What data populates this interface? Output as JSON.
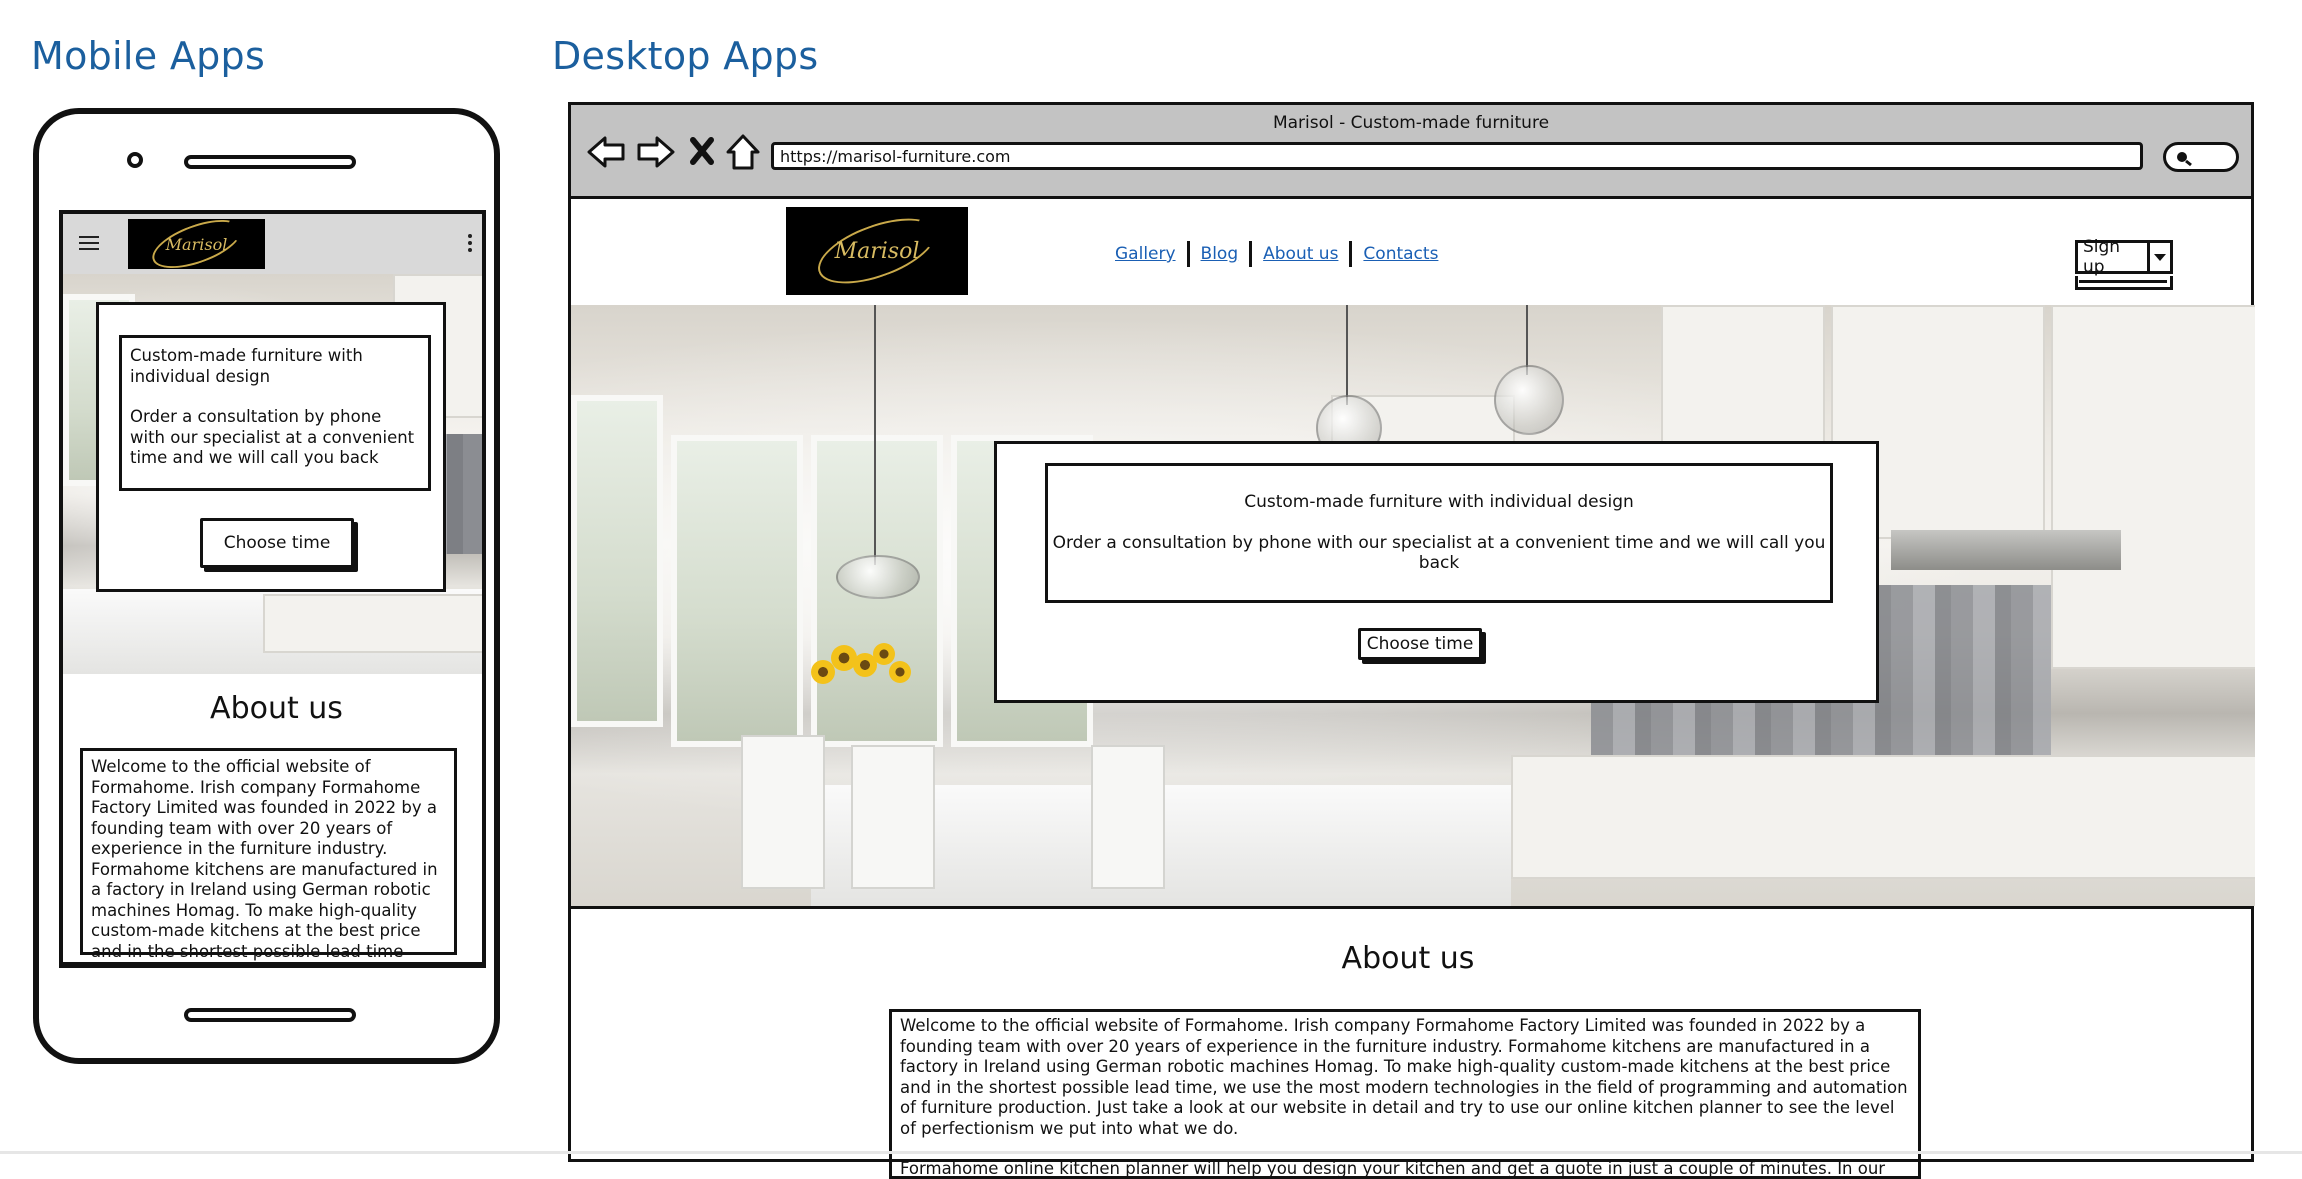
{
  "sections": {
    "mobile_title": "Mobile Apps",
    "desktop_title": "Desktop Apps"
  },
  "brand": {
    "logo_text": "Marisol",
    "logo_bg": "#000000",
    "logo_gold": "#c9a94a"
  },
  "mobile": {
    "hero_title": "Custom-made furniture with individual design",
    "hero_text": "Order a consultation by phone with our specialist at a convenient time and we will call you back",
    "cta_label": "Choose time",
    "about_heading": "About us",
    "about_text": "Welcome to the official website of Formahome. Irish company Formahome Factory Limited was founded in 2022 by a founding team with over 20 years of experience in the furniture industry. Formahome kitchens are manufactured in a factory in Ireland using German robotic machines Homag. To make high-quality custom-made kitchens at the best price and in the shortest possible lead time"
  },
  "desktop": {
    "window_title": "Marisol - Custom-made furniture",
    "url": "https://marisol-furniture.com",
    "nav": [
      "Gallery",
      "Blog",
      "About us",
      "Contacts"
    ],
    "signup_label": "Sign up",
    "hero_title": "Custom-made furniture with individual design",
    "hero_text": "Order a consultation by phone with our specialist at a convenient time and we will call you back",
    "cta_label": "Choose time",
    "about_heading": "About us",
    "about_p1": "Welcome to the official website of Formahome. Irish company Formahome Factory Limited was founded in 2022 by a founding team with over 20 years of experience in the furniture industry. Formahome kitchens are manufactured in a factory in Ireland using German robotic machines Homag. To make high-quality custom-made kitchens at the best price and in the shortest possible lead time, we use the most modern technologies in the field of programming and automation of furniture production. Just take a look at our website in detail and try to use our online kitchen planner to see the level of perfectionism we put into what we do.",
    "about_p2": "Formahome online kitchen planner will help you design your kitchen and get a quote in just a couple of minutes. In our catalog of"
  },
  "colors": {
    "heading": "#1b5f9e",
    "link": "#1a5fb4",
    "chrome": "#c3c3c3"
  },
  "icons": [
    "back-arrow-icon",
    "forward-arrow-icon",
    "stop-icon",
    "home-icon",
    "search-icon",
    "hamburger-menu-icon",
    "kebab-menu-icon",
    "caret-down-icon"
  ]
}
